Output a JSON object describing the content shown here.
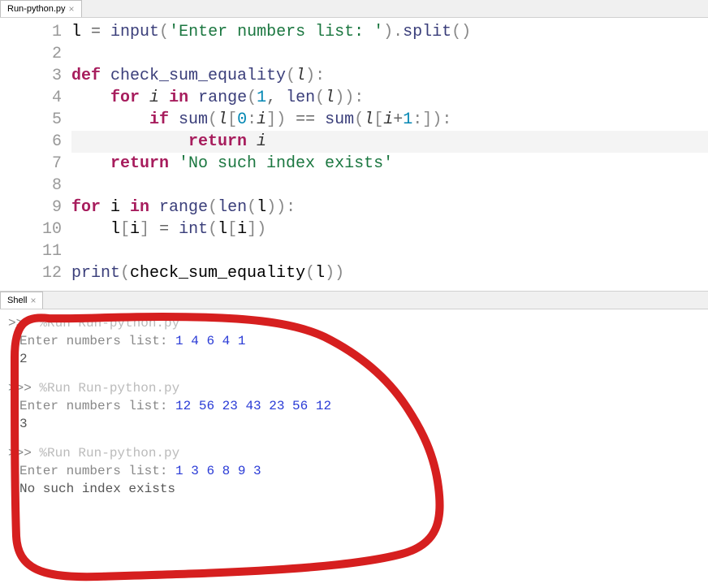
{
  "tabs": {
    "editor": {
      "label": "Run-python.py"
    },
    "shell": {
      "label": "Shell"
    }
  },
  "code": {
    "lines": [
      {
        "n": "1",
        "tokens": [
          [
            "",
            "l "
          ],
          [
            "op",
            "= "
          ],
          [
            "fn",
            "input"
          ],
          [
            "paren",
            "("
          ],
          [
            "str",
            "'Enter numbers list: '"
          ],
          [
            "paren",
            ")"
          ],
          [
            "dot",
            "."
          ],
          [
            "fn",
            "split"
          ],
          [
            "paren",
            "()"
          ]
        ]
      },
      {
        "n": "2",
        "tokens": []
      },
      {
        "n": "3",
        "tokens": [
          [
            "kw",
            "def "
          ],
          [
            "fn",
            "check_sum_equality"
          ],
          [
            "paren",
            "("
          ],
          [
            "var",
            "l"
          ],
          [
            "paren",
            ")"
          ],
          [
            "colon",
            ":"
          ]
        ]
      },
      {
        "n": "4",
        "tokens": [
          [
            "",
            "    "
          ],
          [
            "kw",
            "for "
          ],
          [
            "var",
            "i"
          ],
          [
            "",
            " "
          ],
          [
            "kw",
            "in "
          ],
          [
            "fn",
            "range"
          ],
          [
            "paren",
            "("
          ],
          [
            "num",
            "1"
          ],
          [
            "op",
            ", "
          ],
          [
            "fn",
            "len"
          ],
          [
            "paren",
            "("
          ],
          [
            "var",
            "l"
          ],
          [
            "paren",
            "))"
          ],
          [
            "colon",
            ":"
          ]
        ]
      },
      {
        "n": "5",
        "tokens": [
          [
            "",
            "        "
          ],
          [
            "kw",
            "if "
          ],
          [
            "fn",
            "sum"
          ],
          [
            "paren",
            "("
          ],
          [
            "var",
            "l"
          ],
          [
            "paren",
            "["
          ],
          [
            "num",
            "0"
          ],
          [
            "colon",
            ":"
          ],
          [
            "var",
            "i"
          ],
          [
            "paren",
            "]) "
          ],
          [
            "op",
            "== "
          ],
          [
            "fn",
            "sum"
          ],
          [
            "paren",
            "("
          ],
          [
            "var",
            "l"
          ],
          [
            "paren",
            "["
          ],
          [
            "var",
            "i"
          ],
          [
            "op",
            "+"
          ],
          [
            "num",
            "1"
          ],
          [
            "colon",
            ":"
          ],
          [
            "paren",
            "])"
          ],
          [
            "colon",
            ":"
          ]
        ]
      },
      {
        "n": "6",
        "hl": true,
        "tokens": [
          [
            "",
            "            "
          ],
          [
            "kw",
            "return "
          ],
          [
            "var",
            "i"
          ]
        ]
      },
      {
        "n": "7",
        "tokens": [
          [
            "",
            "    "
          ],
          [
            "kw",
            "return "
          ],
          [
            "str",
            "'No such index exists'"
          ]
        ]
      },
      {
        "n": "8",
        "tokens": []
      },
      {
        "n": "9",
        "tokens": [
          [
            "kw",
            "for "
          ],
          [
            "",
            "i "
          ],
          [
            "kw",
            "in "
          ],
          [
            "fn",
            "range"
          ],
          [
            "paren",
            "("
          ],
          [
            "fn",
            "len"
          ],
          [
            "paren",
            "("
          ],
          [
            "",
            "l"
          ],
          [
            "paren",
            "))"
          ],
          [
            "colon",
            ":"
          ]
        ]
      },
      {
        "n": "10",
        "tokens": [
          [
            "",
            "    l"
          ],
          [
            "paren",
            "["
          ],
          [
            "",
            "i"
          ],
          [
            "paren",
            "] "
          ],
          [
            "op",
            "= "
          ],
          [
            "fn",
            "int"
          ],
          [
            "paren",
            "("
          ],
          [
            "",
            "l"
          ],
          [
            "paren",
            "["
          ],
          [
            "",
            "i"
          ],
          [
            "paren",
            "])"
          ]
        ]
      },
      {
        "n": "11",
        "tokens": []
      },
      {
        "n": "12",
        "tokens": [
          [
            "fn",
            "print"
          ],
          [
            "paren",
            "("
          ],
          [
            "",
            "check_sum_equality"
          ],
          [
            "paren",
            "("
          ],
          [
            "",
            "l"
          ],
          [
            "paren",
            "))"
          ]
        ]
      }
    ]
  },
  "shell": {
    "prompt": ">>>",
    "runs": [
      {
        "cmd": "%Run Run-python.py",
        "label": "Enter numbers list: ",
        "input": "1 4 6 4 1",
        "output": "2"
      },
      {
        "cmd": "%Run Run-python.py",
        "label": "Enter numbers list: ",
        "input": "12 56 23 43 23 56 12",
        "output": "3"
      },
      {
        "cmd": "%Run Run-python.py",
        "label": "Enter numbers list: ",
        "input": "1 3 6 8 9 3",
        "output": "No such index exists"
      }
    ]
  },
  "annotation": {
    "stroke": "#d61f1f",
    "width": 10
  }
}
